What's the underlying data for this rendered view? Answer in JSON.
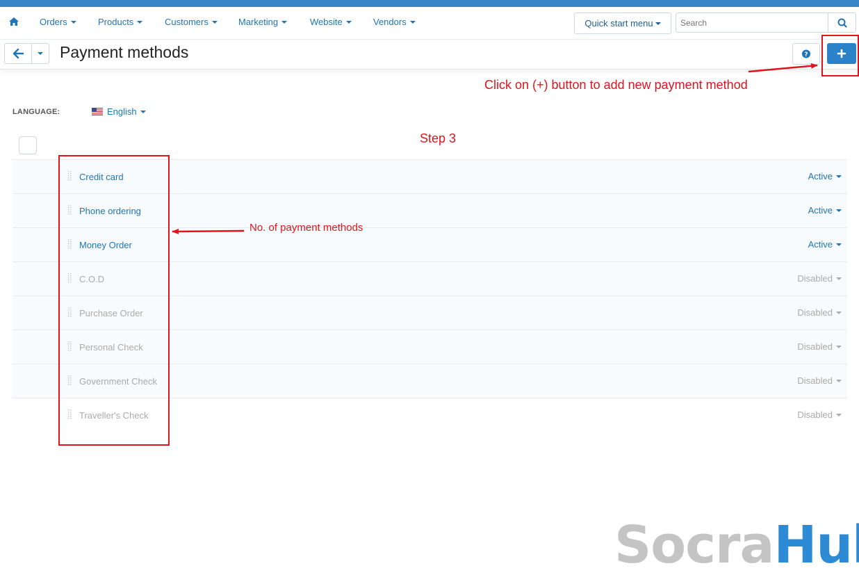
{
  "nav": {
    "items": [
      {
        "label": "Orders"
      },
      {
        "label": "Products"
      },
      {
        "label": "Customers"
      },
      {
        "label": "Marketing"
      },
      {
        "label": "Website"
      },
      {
        "label": "Vendors"
      }
    ],
    "quick_start_label": "Quick start menu",
    "search_placeholder": "Search",
    "icons": {
      "home": "home-icon",
      "search": "search-icon"
    }
  },
  "toolbar": {
    "page_title": "Payment methods",
    "icons": {
      "back": "arrow-left-icon",
      "dropdown": "chevron-down-icon",
      "help": "help-icon",
      "add": "plus-icon"
    }
  },
  "language": {
    "label": "LANGUAGE:",
    "value": "English",
    "flag_icon": "us-flag-icon"
  },
  "payment_methods": [
    {
      "name": "Credit card",
      "status": "Active"
    },
    {
      "name": "Phone ordering",
      "status": "Active"
    },
    {
      "name": "Money Order",
      "status": "Active"
    },
    {
      "name": "C.O.D",
      "status": "Disabled"
    },
    {
      "name": "Purchase Order",
      "status": "Disabled"
    },
    {
      "name": "Personal Check",
      "status": "Disabled"
    },
    {
      "name": "Government Check",
      "status": "Disabled"
    },
    {
      "name": "Traveller's Check",
      "status": "Disabled"
    }
  ],
  "annotations": {
    "add_hint": "Click on (+) button to add new payment method",
    "step": "Step 3",
    "list_hint": "No. of payment methods"
  },
  "watermark": {
    "part1": "Socra",
    "part2": "Hub"
  },
  "colors": {
    "brand_blue": "#2c82c9",
    "link_blue": "#1f74b5",
    "disabled_gray": "#aaaaaa",
    "annotation_red": "#e0141b",
    "top_strip": "#3b86c8"
  }
}
